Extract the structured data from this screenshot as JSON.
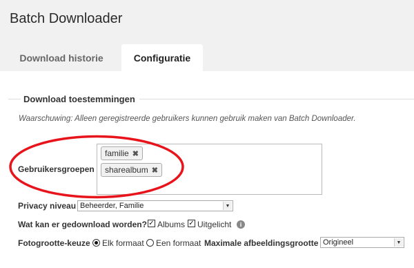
{
  "app": {
    "title": "Batch Downloader"
  },
  "tabs": [
    {
      "label": "Download historie",
      "active": false
    },
    {
      "label": "Configuratie",
      "active": true
    }
  ],
  "section": {
    "legend": "Download toestemmingen",
    "warning": "Waarschuwing: Alleen geregistreerde gebruikers kunnen gebruik maken van Batch Downloader."
  },
  "groups": {
    "label": "Gebruikersgroepen",
    "tags": [
      "familie",
      "sharealbum"
    ],
    "remove_glyph": "✖"
  },
  "privacy": {
    "label": "Privacy niveau",
    "value": "Beheerder, Familie"
  },
  "download": {
    "label": "Wat kan er gedownload worden?",
    "options": [
      {
        "label": "Albums",
        "checked": true
      },
      {
        "label": "Uitgelicht",
        "checked": true
      }
    ],
    "check_glyph": "✓",
    "info_glyph": "i"
  },
  "photosize": {
    "label": "Fotogrootte-keuze",
    "options": [
      {
        "label": "Elk formaat",
        "selected": true
      },
      {
        "label": "Een formaat",
        "selected": false
      }
    ],
    "max_label": "Maximale afbeeldingsgrootte",
    "max_value": "Origineel"
  },
  "select_arrow_glyph": "▼",
  "colors": {
    "annotation": "#e8141c",
    "header_bg": "#f1f1f1"
  }
}
